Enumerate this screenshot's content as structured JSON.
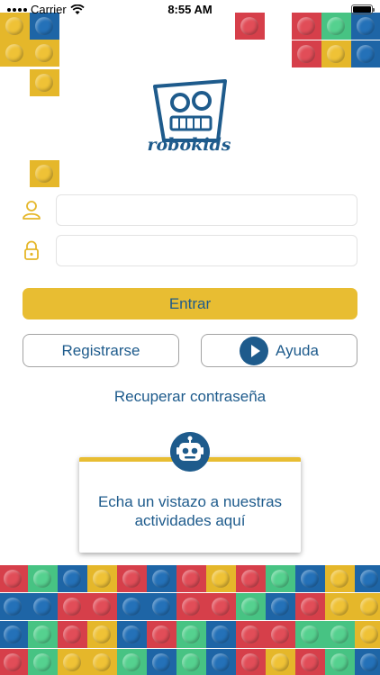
{
  "status_bar": {
    "carrier": "Carrier",
    "time": "8:55 AM"
  },
  "logo": {
    "text": "robokids"
  },
  "login": {
    "user_placeholder": "",
    "password_placeholder": ""
  },
  "buttons": {
    "enter": "Entrar",
    "register": "Registrarse",
    "help": "Ayuda"
  },
  "recover_link": "Recuperar contraseña",
  "activities_card": {
    "text": "Echa un vistazo a nuestras actividades aquí"
  },
  "colors": {
    "brand_blue": "#1e5b8c",
    "yellow": "#e8bd32",
    "red": "#d63f4a",
    "green": "#47c383",
    "lego_blue": "#1e65a6"
  },
  "bottom_grid": [
    [
      "red",
      "green",
      "blue",
      "yellow",
      "red",
      "blue",
      "red",
      "yellow",
      "red",
      "green",
      "blue",
      "yellow",
      "blue"
    ],
    [
      "blue",
      "blue",
      "red",
      "red",
      "blue",
      "blue",
      "red",
      "red",
      "green",
      "blue",
      "red",
      "yellow",
      "yellow"
    ],
    [
      "blue",
      "green",
      "red",
      "yellow",
      "blue",
      "red",
      "green",
      "blue",
      "red",
      "red",
      "green",
      "green",
      "yellow"
    ],
    [
      "red",
      "green",
      "yellow",
      "yellow",
      "green",
      "blue",
      "green",
      "blue",
      "red",
      "yellow",
      "red",
      "green",
      "blue"
    ]
  ]
}
